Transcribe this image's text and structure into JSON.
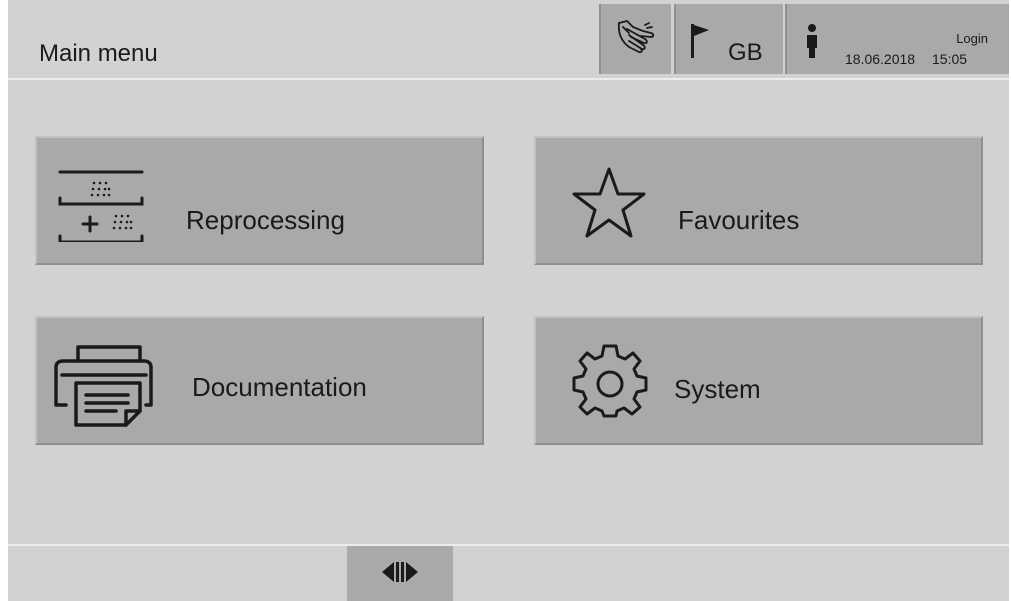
{
  "header": {
    "title": "Main menu",
    "language": "GB",
    "login_label": "Login",
    "date": "18.06.2018",
    "time": "15:05",
    "icons": [
      "hand-disinfection-icon",
      "flag-icon",
      "person-icon"
    ]
  },
  "tiles": [
    {
      "label": "Reprocessing",
      "icon": "reprocessing-icon"
    },
    {
      "label": "Favourites",
      "icon": "star-icon"
    },
    {
      "label": "Documentation",
      "icon": "printer-icon"
    },
    {
      "label": "System",
      "icon": "gear-icon"
    }
  ],
  "footer": {
    "nav_icon": "split-arrows-icon"
  },
  "colors": {
    "background": "#d2d2d2",
    "button": "#a9a9a9",
    "text": "#1a1a1a"
  }
}
